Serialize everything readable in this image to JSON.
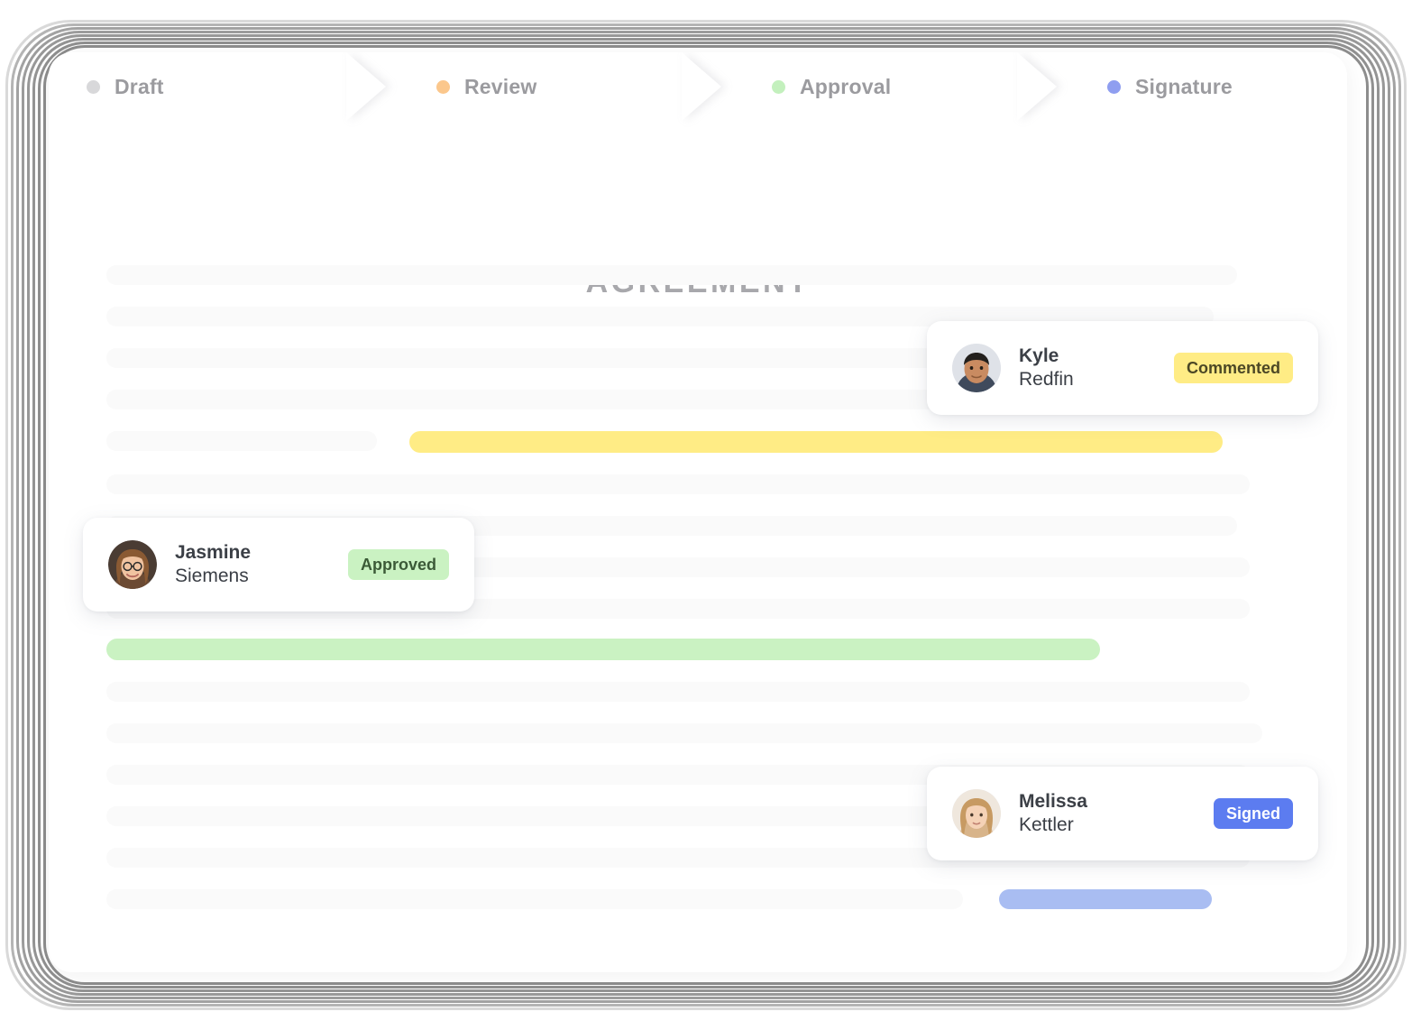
{
  "frame": {
    "name": "tablet-device-frame",
    "ring_color": "#9a9a9a"
  },
  "stepbar": {
    "name": "document-status-stepper",
    "steps": [
      {
        "label": "Draft",
        "dot_color": "#d8d8da",
        "state": "complete"
      },
      {
        "label": "Review",
        "dot_color": "#fbc78c",
        "state": "complete"
      },
      {
        "label": "Approval",
        "dot_color": "#c3f0bd",
        "state": "complete"
      },
      {
        "label": "Signature",
        "dot_color": "#8f9ef0",
        "state": "current"
      }
    ]
  },
  "document": {
    "title": "AGREEMENT",
    "title_color": "#a8a8ac",
    "placeholder_color": "#fafafa",
    "highlights": {
      "comment_yellow": "#ffec85",
      "approval_green": "#caf2c2",
      "signature_blue": "#a9bdf2"
    }
  },
  "participants": [
    {
      "first_name": "Kyle",
      "last_name": "Redfin",
      "badge": "Commented",
      "badge_bg": "#ffec85",
      "badge_fg": "#4b4725",
      "avatar": "kyle-avatar"
    },
    {
      "first_name": "Jasmine",
      "last_name": "Siemens",
      "badge": "Approved",
      "badge_bg": "#caf2c2",
      "badge_fg": "#3b5a37",
      "avatar": "jasmine-avatar"
    },
    {
      "first_name": "Melissa",
      "last_name": "Kettler",
      "badge": "Signed",
      "badge_bg": "#5c7cf0",
      "badge_fg": "#ffffff",
      "avatar": "melissa-avatar"
    }
  ]
}
